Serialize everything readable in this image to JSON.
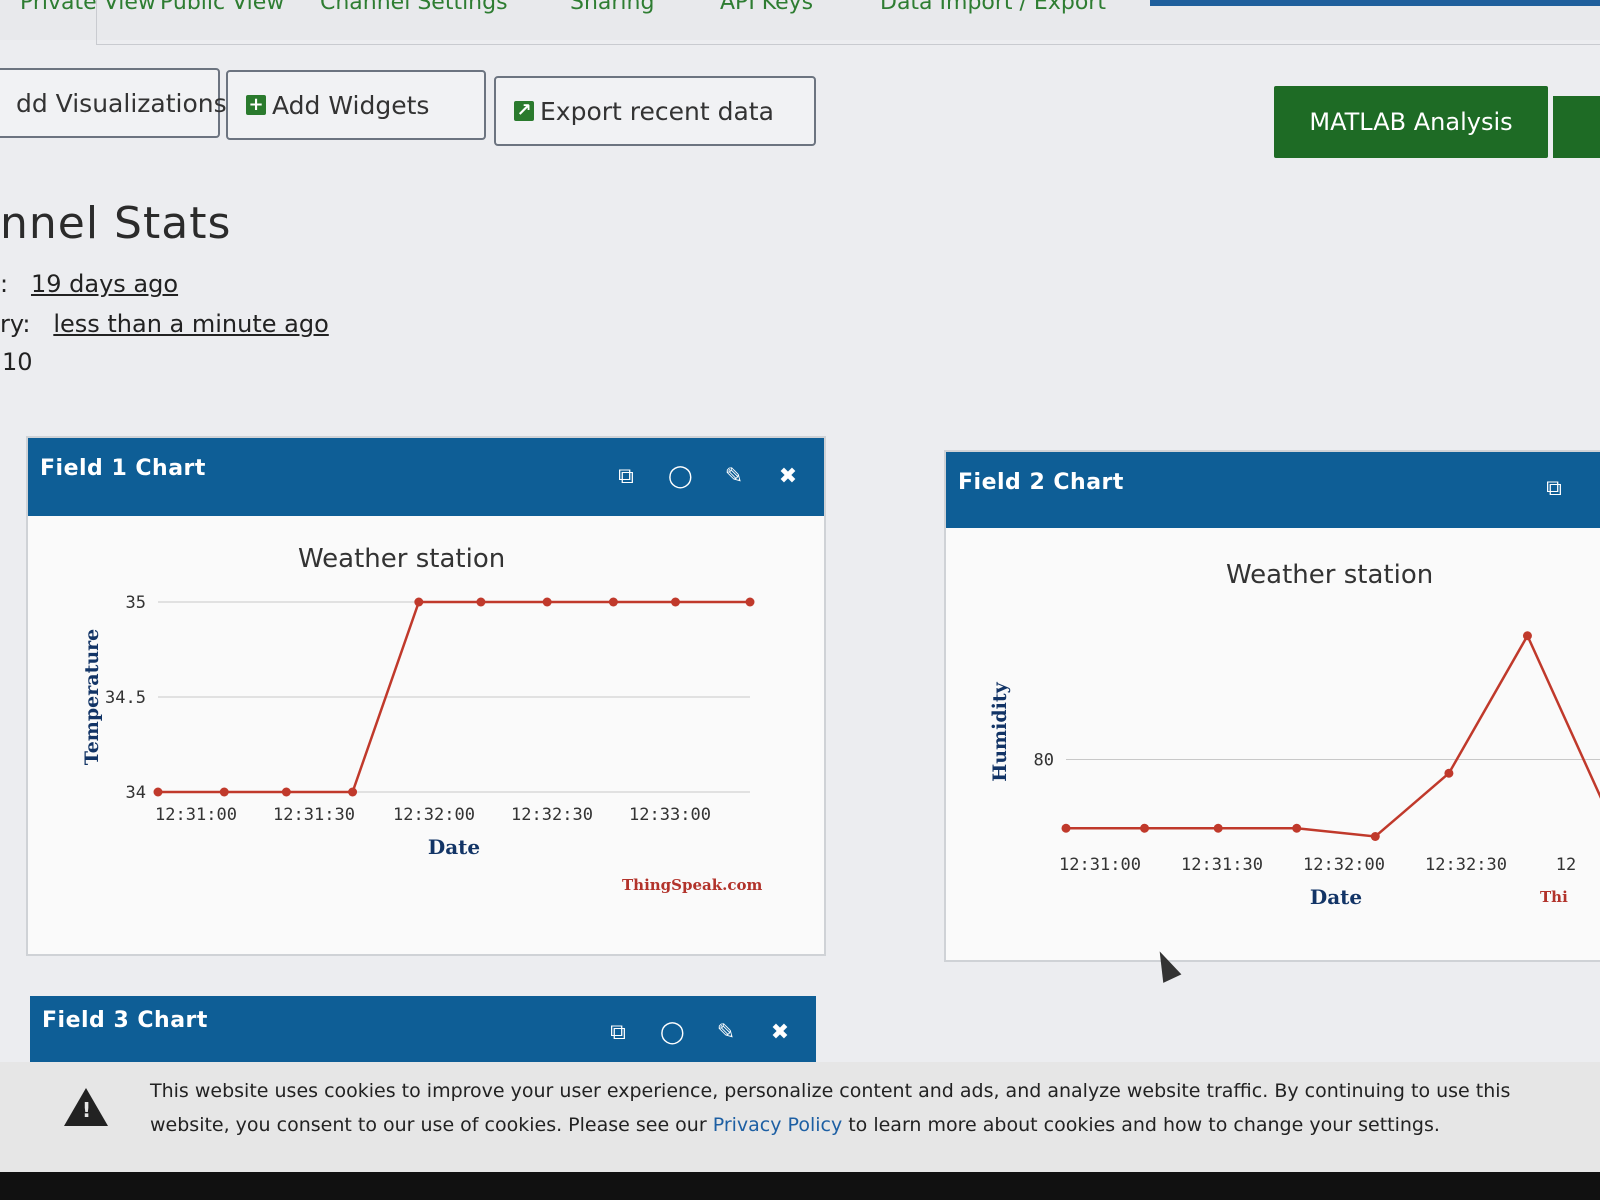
{
  "nav": {
    "tabs": [
      "Private View",
      "Public View",
      "Channel Settings",
      "Sharing",
      "API Keys",
      "Data Import / Export"
    ]
  },
  "toolbar": {
    "add_visualizations": "dd Visualizations",
    "add_widgets": "Add Widgets",
    "export_recent": "Export recent data",
    "matlab_analysis": "MATLAB Analysis"
  },
  "stats": {
    "title": "nnel Stats",
    "created_label": ":",
    "created_value": "19 days ago",
    "last_entry_label": "ry:",
    "last_entry_value": "less than a minute ago",
    "entries_value": "10"
  },
  "panels": [
    {
      "title": "Field 1 Chart"
    },
    {
      "title": "Field 2 Chart"
    },
    {
      "title": "Field 3 Chart"
    }
  ],
  "icons": [
    "external-link-icon",
    "comment-icon",
    "pencil-icon",
    "close-icon"
  ],
  "chart_data": [
    {
      "type": "line",
      "title": "Weather station",
      "xlabel": "Date",
      "ylabel": "Temperature",
      "credit": "ThingSpeak.com",
      "x_ticks": [
        "12:31:00",
        "12:31:30",
        "12:32:00",
        "12:32:30",
        "12:33:00"
      ],
      "y_ticks": [
        "34",
        "34.5",
        "35"
      ],
      "ylim": [
        34,
        35
      ],
      "x": [
        "12:30:52",
        "12:31:08",
        "12:31:23",
        "12:31:39",
        "12:31:55",
        "12:32:10",
        "12:32:26",
        "12:32:42",
        "12:32:57",
        "12:33:15"
      ],
      "series": [
        {
          "values": [
            34,
            34,
            34,
            34,
            35,
            35,
            35,
            35,
            35,
            35
          ]
        }
      ],
      "color": "#c0392b"
    },
    {
      "type": "line",
      "title": "Weather station",
      "xlabel": "Date",
      "ylabel": "Humidity",
      "credit": "Thi",
      "x_ticks": [
        "12:31:00",
        "12:31:30",
        "12:32:00",
        "12:32:30",
        "12"
      ],
      "y_ticks": [
        "80"
      ],
      "x": [
        "12:30:52",
        "12:31:08",
        "12:31:23",
        "12:31:39",
        "12:31:55",
        "12:32:10",
        "12:32:26",
        "12:32:42"
      ],
      "series": [
        {
          "values": [
            77.5,
            77.5,
            77.5,
            77.5,
            77.2,
            79.5,
            84.5,
            78.2
          ]
        }
      ],
      "color": "#c0392b"
    }
  ],
  "cookie": {
    "text1": "This website uses cookies to improve your user experience, personalize content and ads, and analyze website traffic. By continuing to use this website, you consent to our use of cookies. Please see our ",
    "link": "Privacy Policy",
    "text2": " to learn more about cookies and how to change your settings."
  }
}
